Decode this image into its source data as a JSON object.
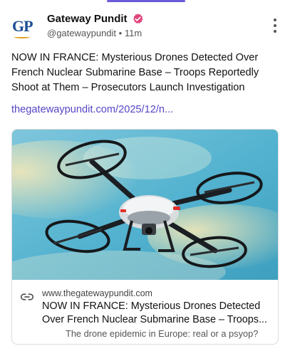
{
  "post": {
    "author_name": "Gateway Pundit",
    "avatar_text": "GP",
    "handle": "@gatewaypundit",
    "separator": "•",
    "time": "11m",
    "text": "NOW IN FRANCE: Mysterious Drones Detected Over French Nuclear Submarine Base – Troops Reportedly Shoot at Them – Prosecutors Launch Investigation",
    "link_text": "thegatewaypundit.com/2025/12/n..."
  },
  "link_card": {
    "image_alt": "Drone flying in sky",
    "domain": "www.thegatewaypundit.com",
    "title_line1": "NOW IN FRANCE: Mysterious Drones Detected",
    "title_line2": "Over French Nuclear Submarine Base – Troops...",
    "description": "The drone epidemic in Europe: real or a psyop?"
  },
  "colors": {
    "accent": "#6b5bd6",
    "link": "#5546c7",
    "verified": "#e0457b",
    "brand_blue": "#1b4f93"
  },
  "icons": {
    "verified": "verified-badge-icon",
    "more": "more-vertical-icon",
    "link": "link-icon"
  }
}
